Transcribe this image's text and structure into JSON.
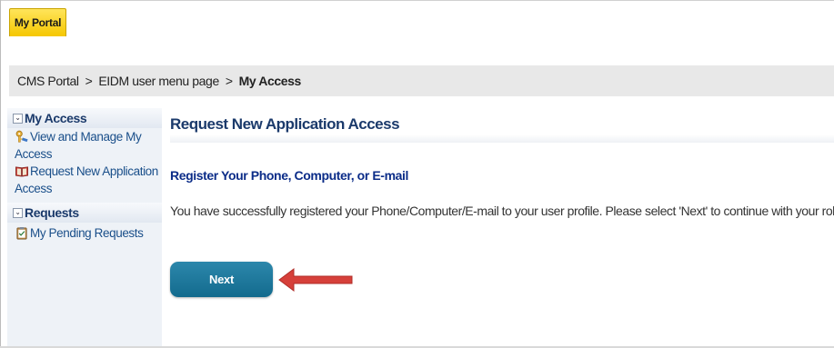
{
  "header": {
    "portal_tab": "My Portal"
  },
  "breadcrumb": {
    "items": [
      "CMS Portal",
      "EIDM user menu page"
    ],
    "separator": ">",
    "current": "My Access"
  },
  "sidebar": {
    "sections": [
      {
        "title": "My Access",
        "items": [
          {
            "line1": "View and Manage My",
            "line2": "Access",
            "icon": "key-icon"
          },
          {
            "line1": "Request New Application",
            "line2": "Access",
            "icon": "book-icon"
          }
        ]
      },
      {
        "title": "Requests",
        "items": [
          {
            "line1": "My Pending Requests",
            "icon": "clipboard-icon"
          }
        ]
      }
    ]
  },
  "main": {
    "title": "Request New Application Access",
    "section_title": "Register Your Phone, Computer, or E-mail",
    "message": "You have successfully registered your Phone/Computer/E-mail to your user profile. Please select 'Next' to continue with your role request.",
    "next_label": "Next"
  },
  "colors": {
    "portal_tab": "#f5c700",
    "sidebar_heading": "#1b3a6b",
    "link": "#1a4f8a",
    "section_title": "#0b2c88",
    "button": "#136b8e",
    "arrow": "#d6403a"
  }
}
